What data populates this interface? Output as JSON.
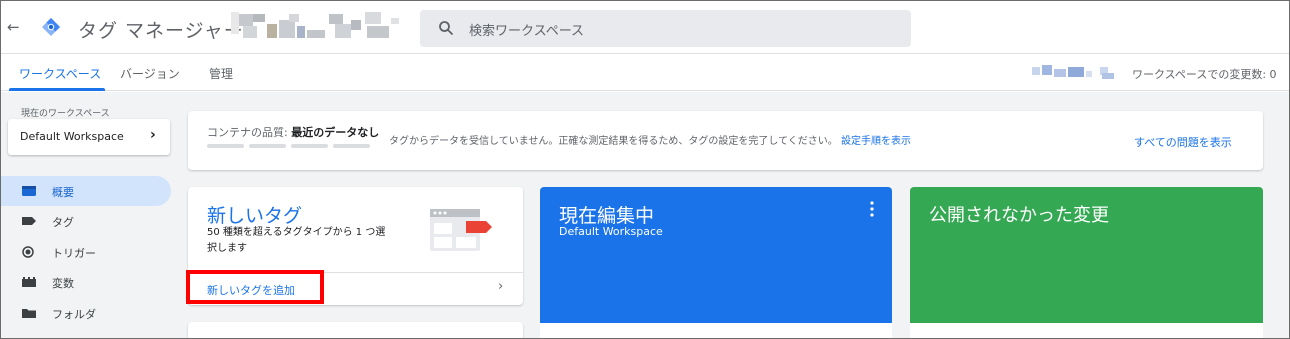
{
  "header": {
    "back_icon": "arrow-left-icon",
    "logo_icon": "gtm-diamond-logo",
    "app_title": "タグ マネージャー",
    "search_placeholder": "検索ワークスペース"
  },
  "tabs": [
    {
      "label": "ワークスペース",
      "active": true
    },
    {
      "label": "バージョン",
      "active": false
    },
    {
      "label": "管理",
      "active": false
    }
  ],
  "workspace_changes": "ワークスペースでの変更数: 0",
  "sidebar": {
    "current_workspace_label": "現在のワークスペース",
    "workspace_name": "Default Workspace",
    "items": [
      {
        "label": "概要",
        "icon": "overview-icon",
        "active": true
      },
      {
        "label": "タグ",
        "icon": "tag-icon",
        "active": false
      },
      {
        "label": "トリガー",
        "icon": "trigger-icon",
        "active": false
      },
      {
        "label": "変数",
        "icon": "variables-icon",
        "active": false
      },
      {
        "label": "フォルダ",
        "icon": "folder-icon",
        "active": false
      }
    ]
  },
  "quality": {
    "label": "コンテナの品質:",
    "value": "最近のデータなし",
    "message": "タグからデータを受信していません。正確な測定結果を得るため、タグの設定を完了してください。",
    "setup_link": "設定手順を表示",
    "view_all": "すべての問題を表示"
  },
  "new_tag_card": {
    "title": "新しいタグ",
    "description": "50 種類を超えるタグタイプから 1 つ選択します",
    "add_link": "新しいタグを追加"
  },
  "editing_card": {
    "title": "現在編集中",
    "subtitle": "Default Workspace"
  },
  "unpublished_card": {
    "title": "公開されなかった変更"
  },
  "colors": {
    "accent_blue": "#1a73e8",
    "editing_blue": "#1a73e8",
    "unpublished_green": "#34a853",
    "highlight_red": "#ff0000"
  }
}
